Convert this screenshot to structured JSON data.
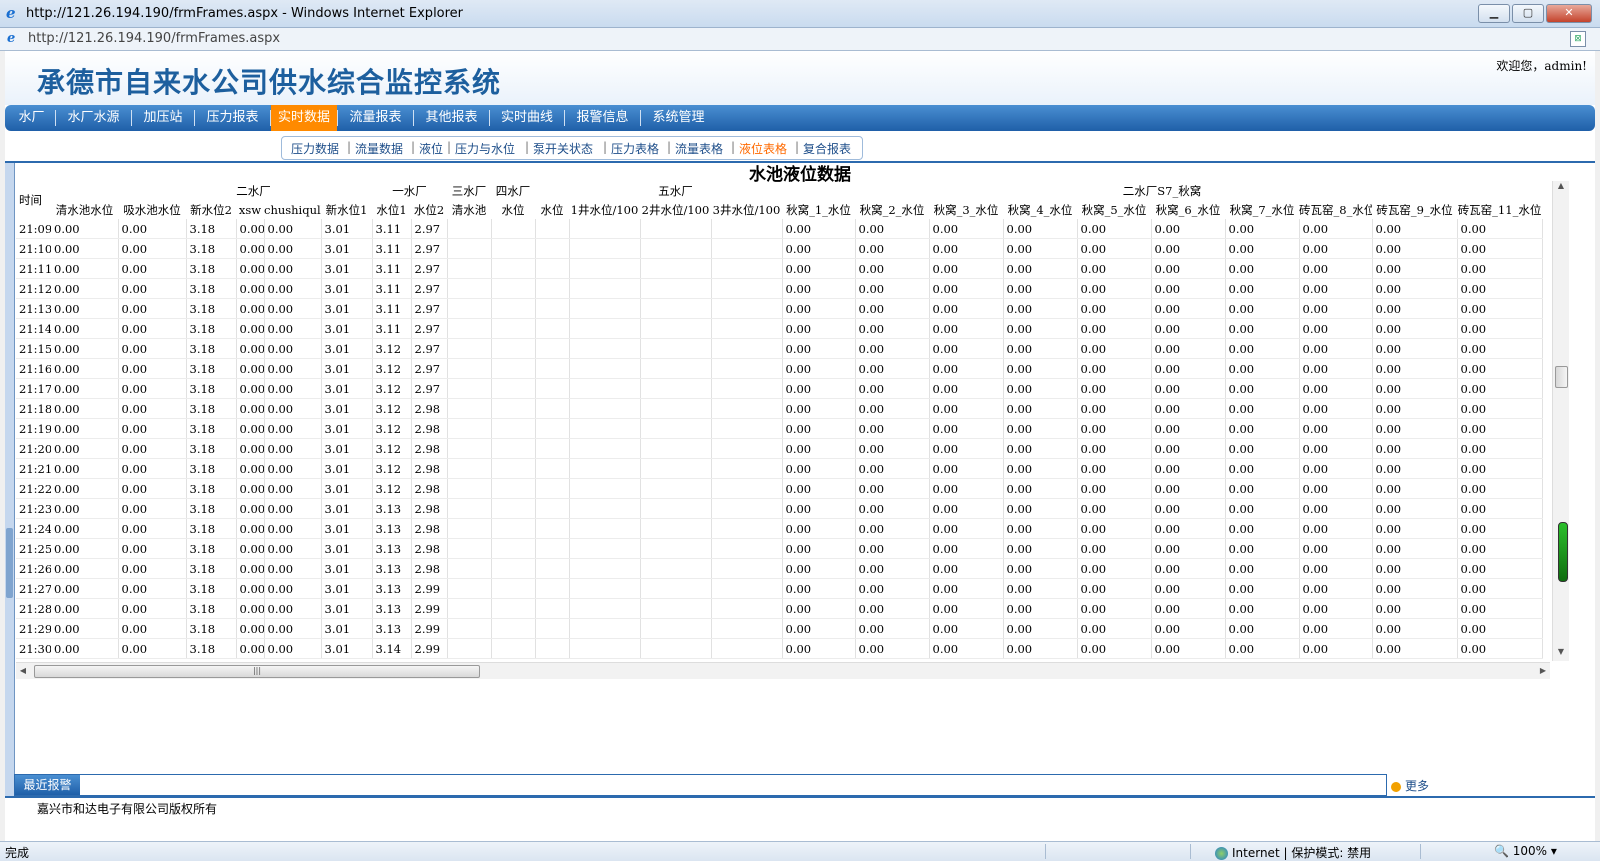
{
  "window": {
    "title": "http://121.26.194.190/frmFrames.aspx - Windows Internet Explorer",
    "url": "http://121.26.194.190/frmFrames.aspx",
    "min": "▁",
    "max": "▢",
    "close": "✕"
  },
  "header": {
    "app_title": "承德市自来水公司供水综合监控系统",
    "welcome": "欢迎您，admin!"
  },
  "nav": [
    "水厂",
    "水厂水源",
    "加压站",
    "压力报表",
    "实时数据",
    "流量报表",
    "其他报表",
    "实时曲线",
    "报警信息",
    "系统管理"
  ],
  "nav_active": "实时数据",
  "subnav": [
    "压力数据",
    "流量数据",
    "液位",
    "压力与水位",
    "泵开关状态",
    "压力表格",
    "流量表格",
    "液位表格",
    "复合报表"
  ],
  "subnav_active": "液位表格",
  "table": {
    "title": "水池液位数据",
    "group_headers": {
      "time": "时间",
      "g1": "二水厂",
      "g2": "一水厂",
      "g3": "三水厂",
      "g4": "四水厂",
      "g5": "五水厂",
      "g6": "二水厂S7_秋窝"
    },
    "columns": [
      "清水池水位",
      "吸水池水位",
      "新水位2",
      "xsw",
      "chushiqull",
      "新水位1",
      "水位1",
      "水位2",
      "清水池",
      "水位",
      "水位",
      "1井水位/100",
      "2井水位/100",
      "3井水位/100",
      "秋窝_1_水位",
      "秋窝_2_水位",
      "秋窝_3_水位",
      "秋窝_4_水位",
      "秋窝_5_水位",
      "秋窝_6_水位",
      "秋窝_7_水位",
      "砖瓦窑_8_水位",
      "砖瓦窑_9_水位",
      "砖瓦窑_11_水位"
    ],
    "rows": [
      {
        "time": "21:09",
        "sw1": "3.11",
        "sw2": "2.97"
      },
      {
        "time": "21:10",
        "sw1": "3.11",
        "sw2": "2.97"
      },
      {
        "time": "21:11",
        "sw1": "3.11",
        "sw2": "2.97"
      },
      {
        "time": "21:12",
        "sw1": "3.11",
        "sw2": "2.97"
      },
      {
        "time": "21:13",
        "sw1": "3.11",
        "sw2": "2.97"
      },
      {
        "time": "21:14",
        "sw1": "3.11",
        "sw2": "2.97"
      },
      {
        "time": "21:15",
        "sw1": "3.12",
        "sw2": "2.97"
      },
      {
        "time": "21:16",
        "sw1": "3.12",
        "sw2": "2.97"
      },
      {
        "time": "21:17",
        "sw1": "3.12",
        "sw2": "2.97"
      },
      {
        "time": "21:18",
        "sw1": "3.12",
        "sw2": "2.98"
      },
      {
        "time": "21:19",
        "sw1": "3.12",
        "sw2": "2.98"
      },
      {
        "time": "21:20",
        "sw1": "3.12",
        "sw2": "2.98"
      },
      {
        "time": "21:21",
        "sw1": "3.12",
        "sw2": "2.98"
      },
      {
        "time": "21:22",
        "sw1": "3.12",
        "sw2": "2.98"
      },
      {
        "time": "21:23",
        "sw1": "3.13",
        "sw2": "2.98"
      },
      {
        "time": "21:24",
        "sw1": "3.13",
        "sw2": "2.98"
      },
      {
        "time": "21:25",
        "sw1": "3.13",
        "sw2": "2.98"
      },
      {
        "time": "21:26",
        "sw1": "3.13",
        "sw2": "2.98"
      },
      {
        "time": "21:27",
        "sw1": "3.13",
        "sw2": "2.99"
      },
      {
        "time": "21:28",
        "sw1": "3.13",
        "sw2": "2.99"
      },
      {
        "time": "21:29",
        "sw1": "3.13",
        "sw2": "2.99"
      },
      {
        "time": "21:30",
        "sw1": "3.14",
        "sw2": "2.99"
      }
    ],
    "const": {
      "zero": "0.00",
      "xin2": "3.18",
      "xin1": "3.01"
    }
  },
  "alarm": {
    "label": "最近报警",
    "more": "更多"
  },
  "footer": "嘉兴市和达电子有限公司版权所有",
  "status": {
    "done": "完成",
    "zone": "Internet | 保护模式: 禁用",
    "zoom": "100%"
  },
  "colors": {
    "nav_blue": "#1f5fa8",
    "nav_active": "#ff8a00",
    "title_blue": "#1d5f9e"
  }
}
